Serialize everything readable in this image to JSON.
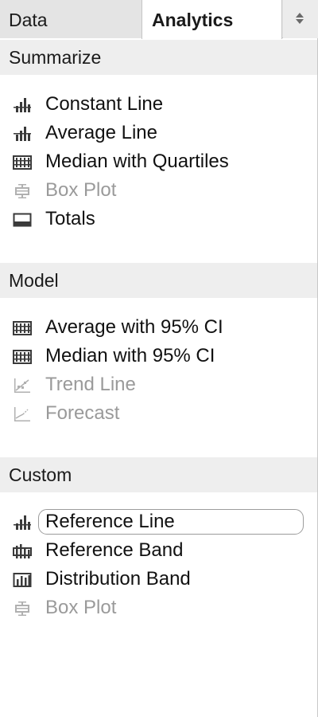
{
  "tabs": {
    "data_label": "Data",
    "analytics_label": "Analytics"
  },
  "sections": {
    "summarize": {
      "title": "Summarize",
      "items": [
        {
          "label": "Constant Line",
          "icon": "constant-line-icon",
          "enabled": true
        },
        {
          "label": "Average Line",
          "icon": "average-line-icon",
          "enabled": true
        },
        {
          "label": "Median with Quartiles",
          "icon": "median-quartiles-icon",
          "enabled": true
        },
        {
          "label": "Box Plot",
          "icon": "box-plot-icon",
          "enabled": false
        },
        {
          "label": "Totals",
          "icon": "totals-icon",
          "enabled": true
        }
      ]
    },
    "model": {
      "title": "Model",
      "items": [
        {
          "label": "Average with 95% CI",
          "icon": "average-ci-icon",
          "enabled": true
        },
        {
          "label": "Median with 95% CI",
          "icon": "median-ci-icon",
          "enabled": true
        },
        {
          "label": "Trend Line",
          "icon": "trend-line-icon",
          "enabled": false
        },
        {
          "label": "Forecast",
          "icon": "forecast-icon",
          "enabled": false
        }
      ]
    },
    "custom": {
      "title": "Custom",
      "items": [
        {
          "label": "Reference Line",
          "icon": "reference-line-icon",
          "enabled": true,
          "selected": true
        },
        {
          "label": "Reference Band",
          "icon": "reference-band-icon",
          "enabled": true
        },
        {
          "label": "Distribution Band",
          "icon": "distribution-band-icon",
          "enabled": true
        },
        {
          "label": "Box Plot",
          "icon": "box-plot-icon",
          "enabled": false
        }
      ]
    }
  },
  "colors": {
    "tab_bar": "#e4e4e4",
    "section_header": "#eeeeee",
    "icon_dark": "#3a3a3a",
    "icon_disabled": "#b0b0b0",
    "text_disabled": "#9a9a9a"
  }
}
